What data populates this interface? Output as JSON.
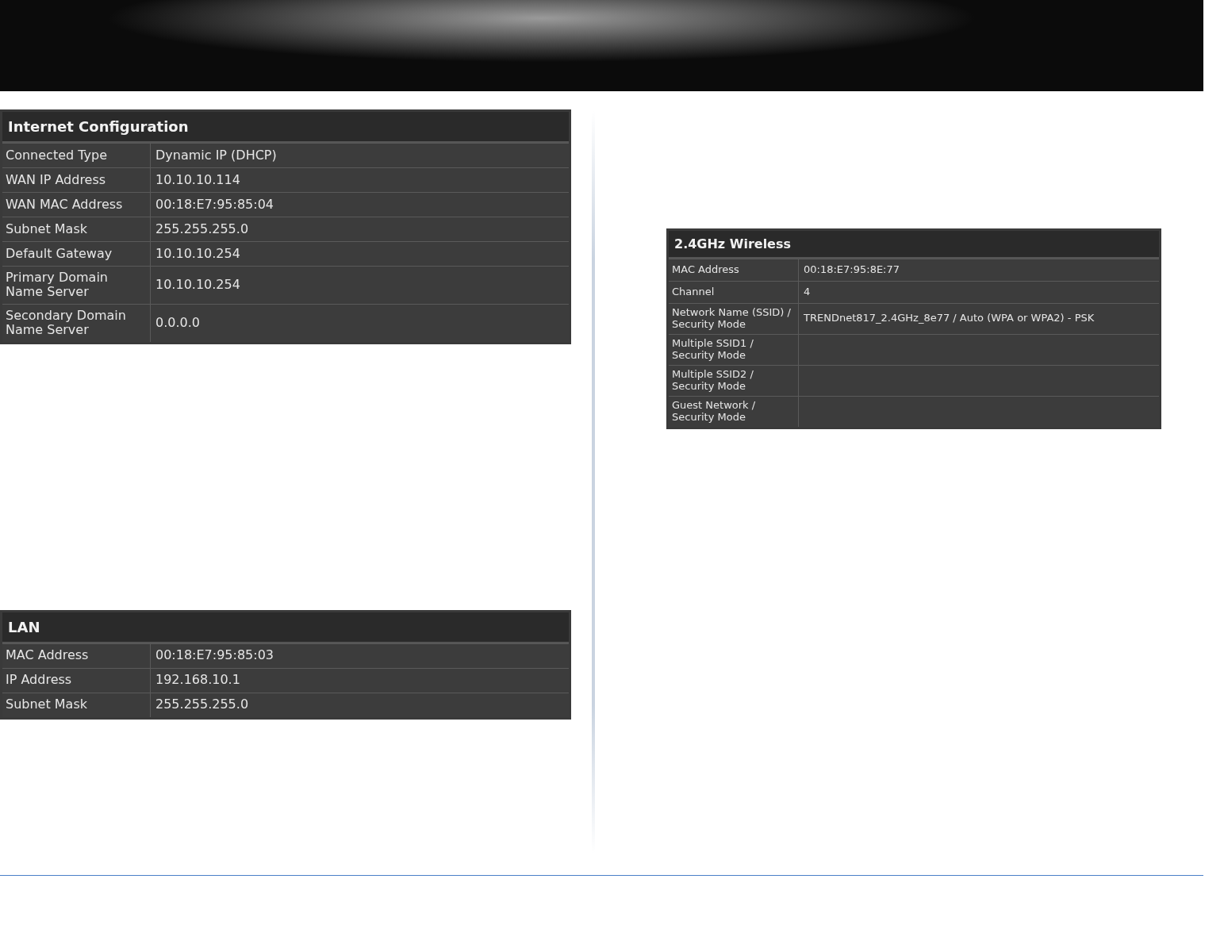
{
  "internet_configuration": {
    "title": "Internet Configuration",
    "rows": [
      {
        "label": "Connected Type",
        "value": "Dynamic IP (DHCP)"
      },
      {
        "label": "WAN IP Address",
        "value": "10.10.10.114"
      },
      {
        "label": "WAN MAC Address",
        "value": "00:18:E7:95:85:04"
      },
      {
        "label": "Subnet Mask",
        "value": "255.255.255.0"
      },
      {
        "label": "Default Gateway",
        "value": "10.10.10.254"
      },
      {
        "label": "Primary Domain Name Server",
        "value": "10.10.10.254"
      },
      {
        "label": "Secondary Domain Name Server",
        "value": "0.0.0.0"
      }
    ]
  },
  "lan": {
    "title": "LAN",
    "rows": [
      {
        "label": "MAC Address",
        "value": "00:18:E7:95:85:03"
      },
      {
        "label": "IP Address",
        "value": "192.168.10.1"
      },
      {
        "label": "Subnet Mask",
        "value": "255.255.255.0"
      }
    ]
  },
  "wireless_2_4ghz": {
    "title": "2.4GHz Wireless",
    "rows": [
      {
        "label": "MAC Address",
        "value": "00:18:E7:95:8E:77"
      },
      {
        "label": "Channel",
        "value": "4"
      },
      {
        "label": "Network Name (SSID) / Security Mode",
        "value": "TRENDnet817_2.4GHz_8e77 / Auto (WPA or WPA2) - PSK"
      },
      {
        "label": "Multiple SSID1 / Security Mode"
      },
      {
        "label": "Multiple SSID2 / Security Mode"
      },
      {
        "label": "Guest Network / Security Mode"
      }
    ]
  }
}
